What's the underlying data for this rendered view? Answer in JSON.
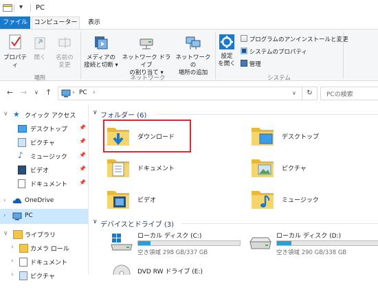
{
  "window": {
    "title": "PC"
  },
  "ribbon_tabs": {
    "file": "ファイル",
    "computer": "コンピューター",
    "view": "表示"
  },
  "ribbon": {
    "location": {
      "properties": "プロパティ",
      "open": "開く",
      "rename_1": "名前の",
      "rename_2": "変更",
      "group": "場所"
    },
    "network": {
      "media_1": "メディアの",
      "media_2": "接続と切断",
      "map_1": "ネットワーク ドライブ",
      "map_2": "の割り当て",
      "add_1": "ネットワークの",
      "add_2": "場所の追加",
      "group": "ネットワーク"
    },
    "system": {
      "settings_1": "設定",
      "settings_2": "を開く",
      "uninstall": "プログラムのアンインストールと変更",
      "sys_props": "システムのプロパティ",
      "manage": "管理",
      "group": "システム"
    }
  },
  "address": {
    "path": "PC",
    "search_placeholder": "PCの検索"
  },
  "nav": {
    "quick_access": "クイック アクセス",
    "desktop": "デスクトップ",
    "pictures": "ピクチャ",
    "music": "ミュージック",
    "videos": "ビデオ",
    "documents": "ドキュメント",
    "onedrive": "OneDrive",
    "pc": "PC",
    "libraries": "ライブラリ",
    "camera_roll": "カメラ ロール",
    "lib_documents": "ドキュメント",
    "lib_pictures": "ピクチャ"
  },
  "content": {
    "folders_header": "フォルダー (6)",
    "folders": {
      "downloads": "ダウンロード",
      "desktop": "デスクトップ",
      "documents": "ドキュメント",
      "pictures": "ピクチャ",
      "videos": "ビデオ",
      "music": "ミュージック"
    },
    "drives_header": "デバイスとドライブ (3)",
    "drives": {
      "c": {
        "name": "ローカル ディスク (C:)",
        "free": "空き領域 298 GB/337 GB",
        "used_fraction": 0.12
      },
      "d": {
        "name": "ローカル ディスク (D:)",
        "free": "空き領域 290 GB/338 GB",
        "used_fraction": 0.14
      },
      "dvd": {
        "name": "DVD RW ドライブ (E:)"
      }
    }
  },
  "colors": {
    "accent": "#1979ca",
    "selection": "#cce8ff",
    "highlight": "#e0252d",
    "folder": "#f3c54a"
  }
}
